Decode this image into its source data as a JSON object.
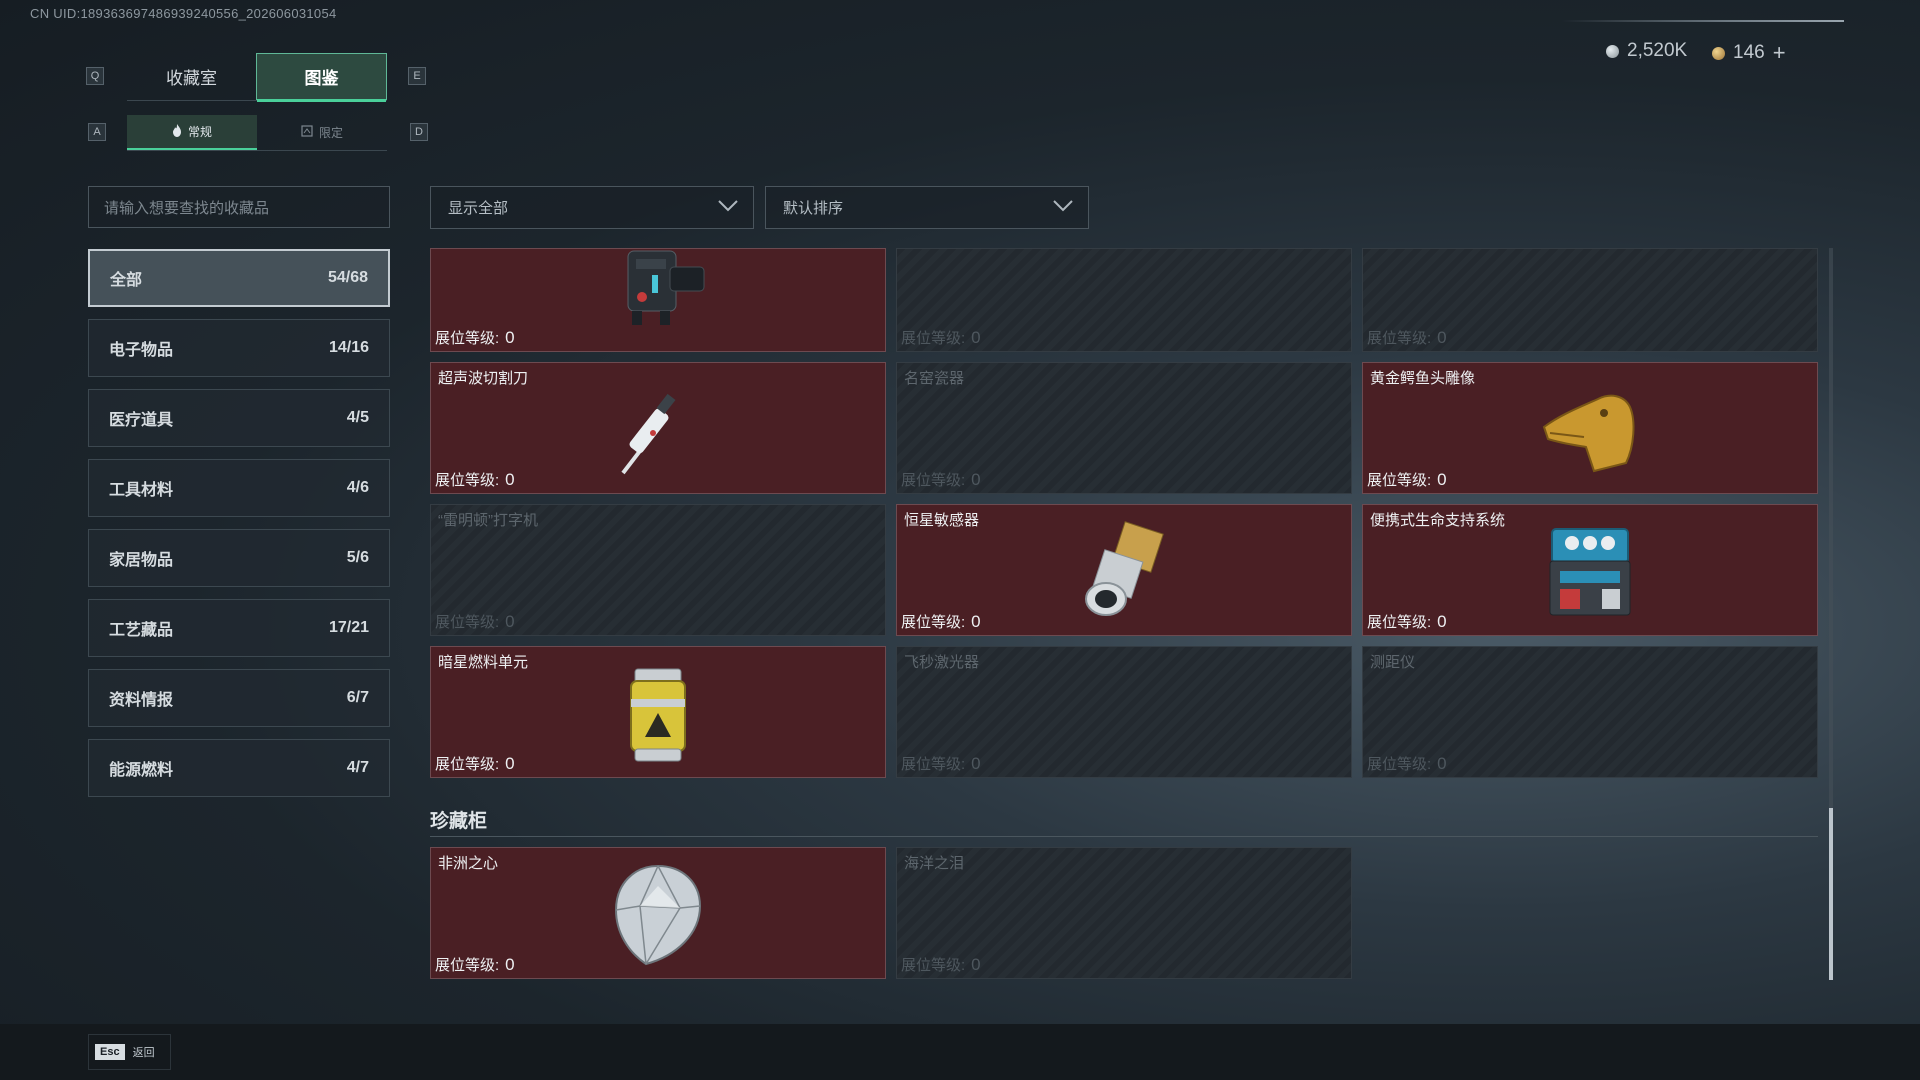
{
  "uid": "CN UID:18936369748693924055​6_202606031054",
  "keys": {
    "q": "Q",
    "e": "E",
    "a": "A",
    "d": "D"
  },
  "tabs": [
    {
      "label": "收藏室",
      "active": false
    },
    {
      "label": "图鉴",
      "active": true
    }
  ],
  "subtabs": [
    {
      "label": "常规",
      "active": true
    },
    {
      "label": "限定",
      "active": false
    }
  ],
  "currency": {
    "silver": {
      "value": "2,520K",
      "icon": "silver-coin-icon",
      "color": "#b9c2c9"
    },
    "gold": {
      "value": "146",
      "plus": "+",
      "icon": "gold-coin-icon",
      "color": "#c9a25a"
    }
  },
  "search": {
    "placeholder": "请输入想要查找的收藏品"
  },
  "categories": [
    {
      "name": "全部",
      "count": "54/68",
      "active": true
    },
    {
      "name": "电子物品",
      "count": "14/16"
    },
    {
      "name": "医疗道具",
      "count": "4/5"
    },
    {
      "name": "工具材料",
      "count": "4/6"
    },
    {
      "name": "家居物品",
      "count": "5/6"
    },
    {
      "name": "工艺藏品",
      "count": "17/21"
    },
    {
      "name": "资料情报",
      "count": "6/7"
    },
    {
      "name": "能源燃料",
      "count": "4/7"
    }
  ],
  "filters": {
    "show": "显示全部",
    "sort": "默认排序",
    "icon": "chevron-down-icon"
  },
  "level_label": "展位等级:",
  "items": [
    {
      "name": "",
      "level": "0",
      "owned": true,
      "icon": "device-icon"
    },
    {
      "name": "",
      "level": "0",
      "owned": false
    },
    {
      "name": "",
      "level": "0",
      "owned": false
    },
    {
      "name": "超声波切割刀",
      "level": "0",
      "owned": true,
      "icon": "cutting-knife-icon"
    },
    {
      "name": "名窑瓷器",
      "level": "0",
      "owned": false
    },
    {
      "name": "黄金鳄鱼头雕像",
      "level": "0",
      "owned": true,
      "icon": "golden-crocodile-icon"
    },
    {
      "name": "“雷明顿”打字机",
      "level": "0",
      "owned": false
    },
    {
      "name": "恒星敏感器",
      "level": "0",
      "owned": true,
      "icon": "star-sensor-icon"
    },
    {
      "name": "便携式生命支持系统",
      "level": "0",
      "owned": true,
      "icon": "life-support-icon"
    },
    {
      "name": "暗星燃料单元",
      "level": "0",
      "owned": true,
      "icon": "fuel-canister-icon"
    },
    {
      "name": "飞秒激光器",
      "level": "0",
      "owned": false
    },
    {
      "name": "测距仪",
      "level": "0",
      "owned": false
    }
  ],
  "section_title": "珍藏柜",
  "treasures": [
    {
      "name": "非洲之心",
      "level": "0",
      "owned": true,
      "icon": "diamond-icon"
    },
    {
      "name": "海洋之泪",
      "level": "0",
      "owned": false
    }
  ],
  "footer": {
    "key": "Esc",
    "label": "返回"
  }
}
